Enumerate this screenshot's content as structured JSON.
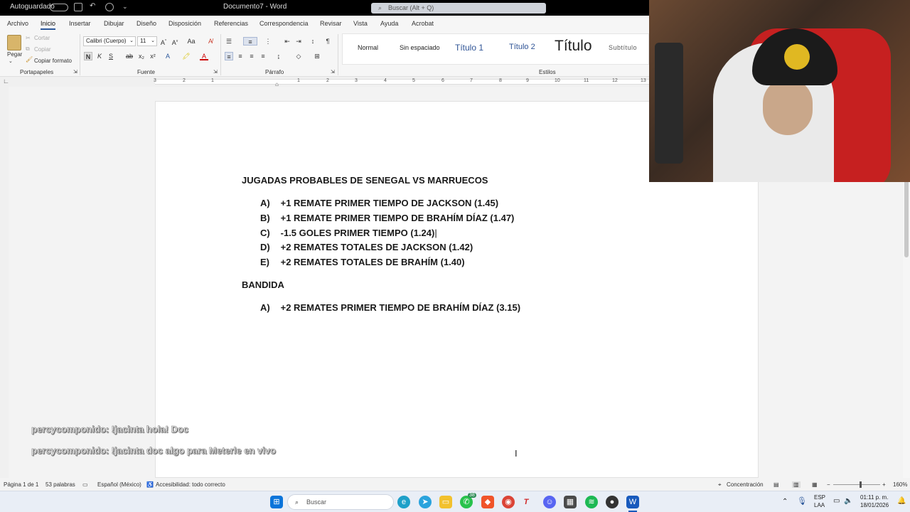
{
  "titlebar": {
    "autosave": "Autoguardado",
    "doc_title": "Documento7 - Word",
    "search_placeholder": "Buscar (Alt + Q)"
  },
  "menu": {
    "items": [
      "Archivo",
      "Inicio",
      "Insertar",
      "Dibujar",
      "Diseño",
      "Disposición",
      "Referencias",
      "Correspondencia",
      "Revisar",
      "Vista",
      "Ayuda",
      "Acrobat"
    ],
    "active": "Inicio"
  },
  "ribbon": {
    "clipboard": {
      "paste": "Pegar",
      "cut": "Cortar",
      "copy": "Copiar",
      "format_painter": "Copiar formato",
      "label": "Portapapeles"
    },
    "font": {
      "family": "Calibri (Cuerpo)",
      "size": "11",
      "label": "Fuente"
    },
    "paragraph": {
      "label": "Párrafo"
    },
    "styles": {
      "items": [
        "Normal",
        "Sin espaciado",
        "Título 1",
        "Título 2",
        "Título",
        "Subtítulo"
      ],
      "label": "Estilos"
    }
  },
  "ruler": {
    "marks": [
      "3",
      "2",
      "1",
      "1",
      "2",
      "3",
      "4",
      "5",
      "6",
      "7",
      "8",
      "9",
      "10",
      "11",
      "12",
      "13",
      "14"
    ]
  },
  "document": {
    "heading1": "JUGADAS PROBABLES DE SENEGAL VS MARRUECOS",
    "list1": [
      {
        "letter": "A)",
        "text": "+1 REMATE PRIMER TIEMPO DE JACKSON (1.45)"
      },
      {
        "letter": "B)",
        "text": "+1 REMATE PRIMER TIEMPO DE BRAHÍM DÍAZ (1.47)"
      },
      {
        "letter": "C)",
        "text": "-1.5 GOLES PRIMER TIEMPO (1.24)"
      },
      {
        "letter": "D)",
        "text": "+2 REMATES TOTALES DE JACKSON (1.42)"
      },
      {
        "letter": "E)",
        "text": "+2 REMATES TOTALES DE BRAHÍM (1.40)"
      }
    ],
    "heading2": "BANDIDA",
    "list2": [
      {
        "letter": "A)",
        "text": "+2 REMATES PRIMER TIEMPO DE BRAHÍM DÍAZ (3.15)"
      }
    ]
  },
  "chat": {
    "messages": [
      "percycomponido: !jacinta hola! Doc",
      "percycomponido: !jacinta doc algo para Meterle en vivo"
    ]
  },
  "statusbar": {
    "page": "Página 1 de 1",
    "words": "53 palabras",
    "language": "Español (México)",
    "accessibility": "Accesibilidad: todo correcto",
    "focus": "Concentración",
    "zoom": "160%"
  },
  "taskbar": {
    "search": "Buscar",
    "whatsapp_badge": "38",
    "lang_top": "ESP",
    "lang_bottom": "LAA",
    "time": "01:11 p. m.",
    "date": "18/01/2026"
  },
  "colors": {
    "word_blue": "#2b579a",
    "ribbon_bg": "#f6f6f6",
    "taskbar_bg": "#e9eef6"
  }
}
